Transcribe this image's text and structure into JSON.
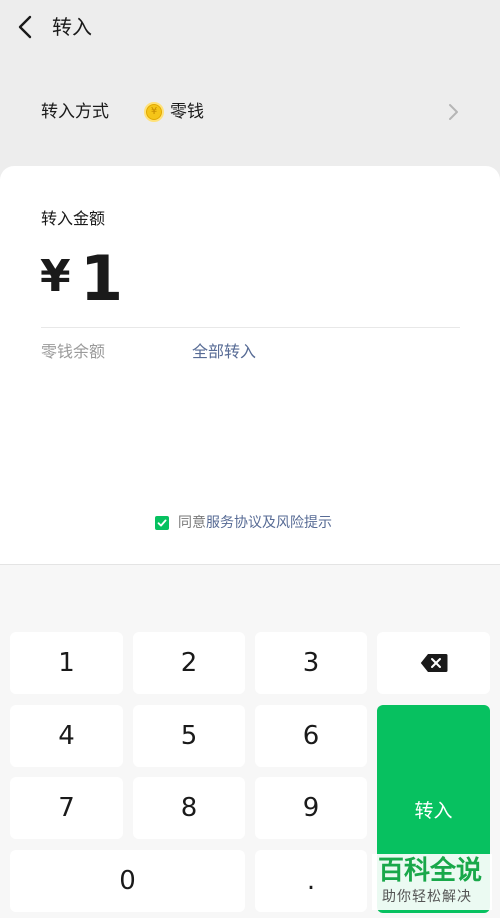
{
  "nav": {
    "title": "转入"
  },
  "method": {
    "label": "转入方式",
    "value": "零钱"
  },
  "amount": {
    "label": "转入金额",
    "currency": "¥",
    "value": "1"
  },
  "balance": {
    "label": "零钱余额",
    "all_in_link": "全部转入"
  },
  "agreement": {
    "prefix": "同意",
    "link": "服务协议及风险提示",
    "checked": true
  },
  "keypad": {
    "keys": [
      "1",
      "2",
      "3",
      "4",
      "5",
      "6",
      "7",
      "8",
      "9",
      "0",
      "."
    ],
    "submit_label": "转入"
  },
  "colors": {
    "accent": "#07c160",
    "link": "#576b95"
  },
  "watermark": {
    "main": "百科全说",
    "sub": "助你轻松解决"
  }
}
